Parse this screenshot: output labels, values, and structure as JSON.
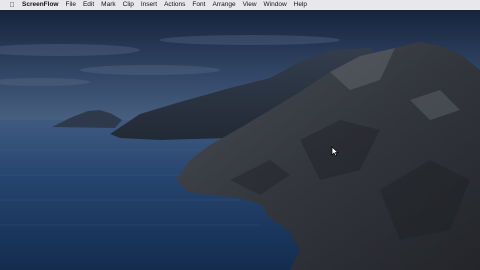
{
  "menubar": {
    "apple_icon": "apple-icon",
    "app_name": "ScreenFlow",
    "items": [
      "File",
      "Edit",
      "Mark",
      "Clip",
      "Insert",
      "Actions",
      "Font",
      "Arrange",
      "View",
      "Window",
      "Help"
    ]
  },
  "desktop": {
    "wallpaper": "coastal-cliffs-at-dusk",
    "colors": {
      "sky_top": "#1d2c46",
      "sky_bottom": "#3c5575",
      "sea": "#22406a",
      "cliff": "#3a3d44"
    }
  },
  "cursor": {
    "icon": "arrow-cursor-icon"
  }
}
